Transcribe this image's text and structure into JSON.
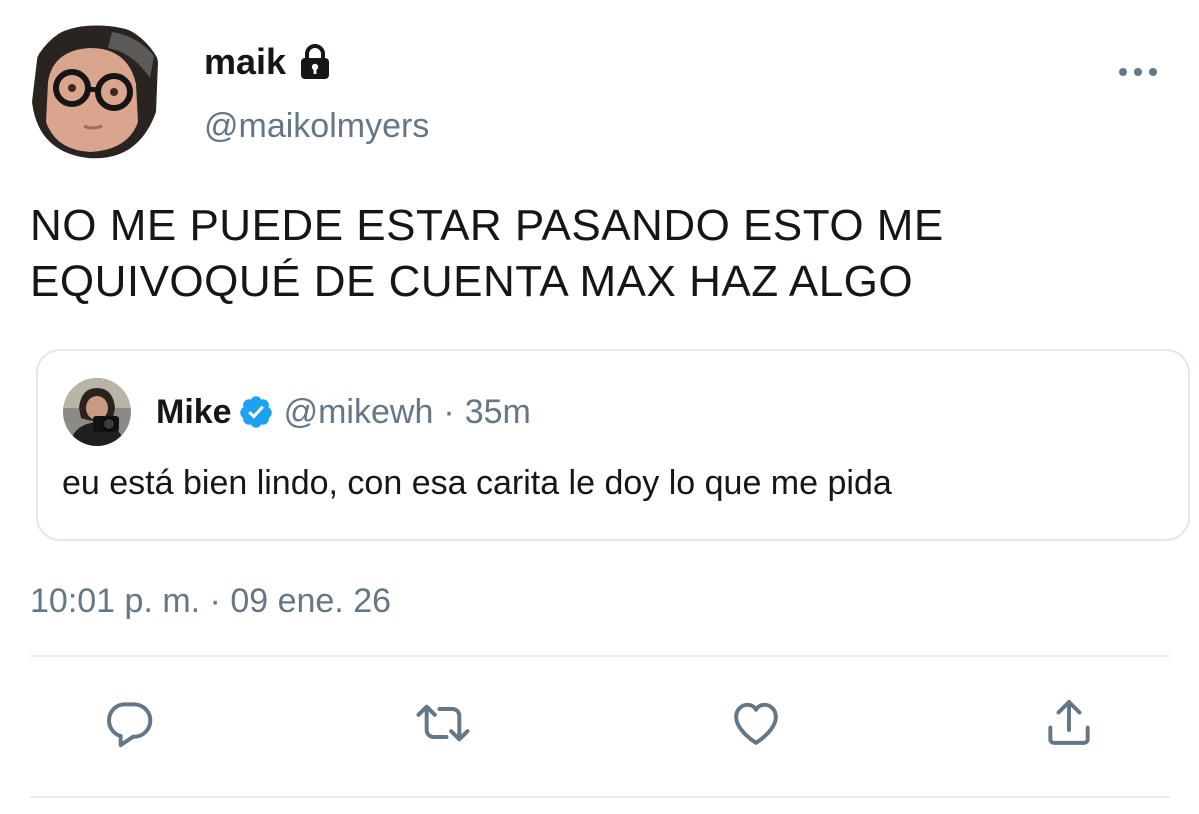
{
  "tweet": {
    "author": {
      "display_name": "maik",
      "handle": "@maikolmyers",
      "protected_icon": "lock-icon"
    },
    "text_lines": [
      "NO ME PUEDE ESTAR PASANDO ESTO ME",
      "EQUIVOQUÉ DE CUENTA MAX HAZ ALGO"
    ],
    "more_icon": "more-horizontal-icon",
    "quoted": {
      "display_name": "Mike",
      "verified_icon": "verified-badge-icon",
      "handle": "@mikewh",
      "separator": "·",
      "time_ago": "35m",
      "text": "eu está bien lindo, con esa carita le doy lo que me pida"
    },
    "timestamp": "10:01 p. m. · 09 ene. 26",
    "actions": [
      {
        "name": "reply",
        "icon": "reply-icon"
      },
      {
        "name": "retweet",
        "icon": "retweet-icon"
      },
      {
        "name": "like",
        "icon": "heart-icon"
      },
      {
        "name": "share",
        "icon": "share-icon"
      }
    ]
  },
  "colors": {
    "text_primary": "#14171a",
    "text_secondary": "#657786",
    "border": "#e1e8ed",
    "verified": "#1da1f2"
  }
}
